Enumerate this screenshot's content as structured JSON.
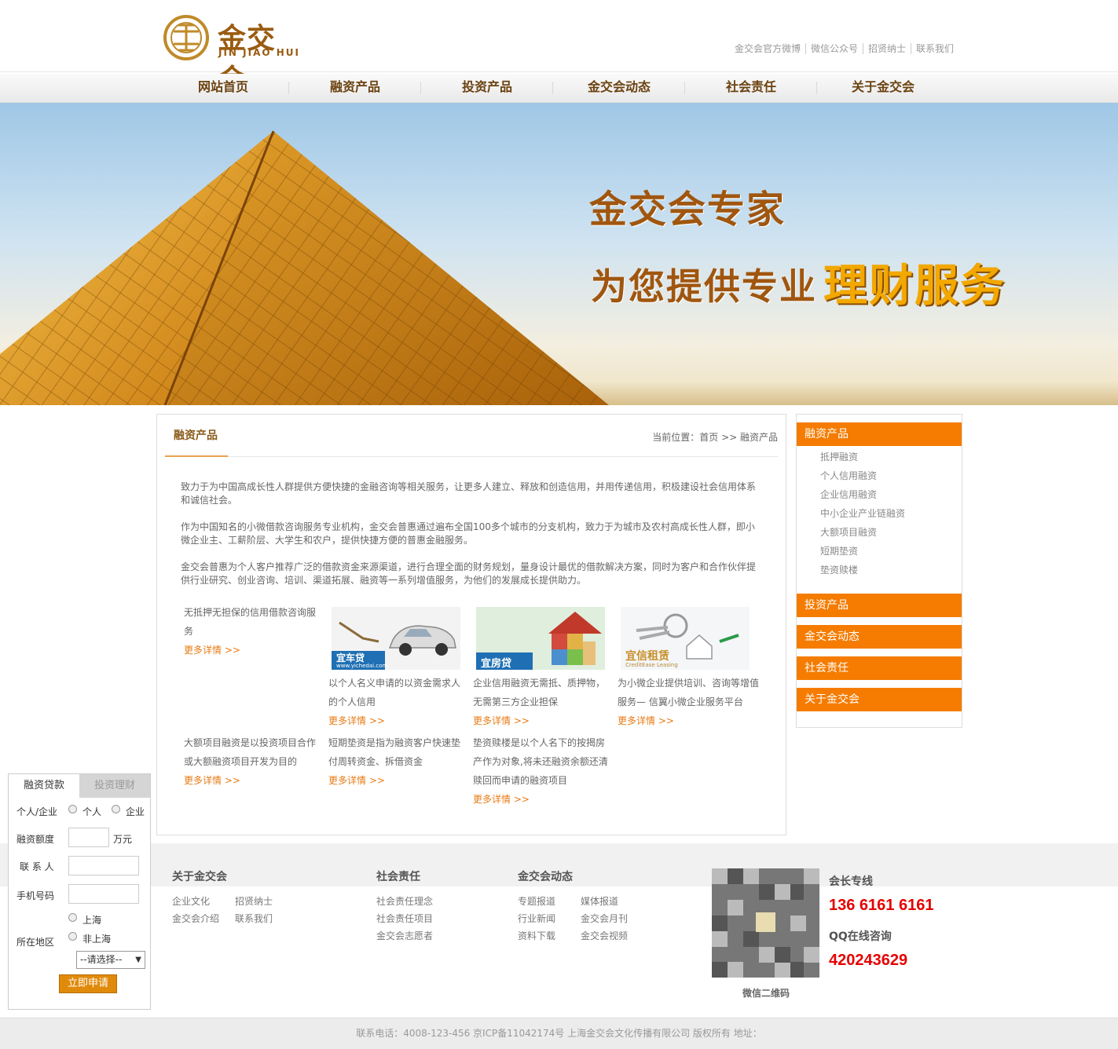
{
  "logo": {
    "cn": "金交会",
    "en": "JIN JIAO HUI"
  },
  "toplinks": [
    "金交会官方微博",
    "微信公众号",
    "招贤纳士",
    "联系我们"
  ],
  "nav": [
    "网站首页",
    "融资产品",
    "投资产品",
    "金交会动态",
    "社会责任",
    "关于金交会"
  ],
  "banner": {
    "line1": "金交会专家",
    "line2": "为您提供专业",
    "highlight": "理财服务"
  },
  "content": {
    "title": "融资产品",
    "breadcrumb": "当前位置：首页 >> 融资产品",
    "paragraphs": [
      "致力于为中国高成长性人群提供方便快捷的金融咨询等相关服务，让更多人建立、释放和创造信用，并用传递信用，积极建设社会信用体系和诚信社会。",
      "作为中国知名的小微借款咨询服务专业机构，金交会普惠通过遍布全国100多个城市的分支机构，致力于为城市及农村高成长性人群，即小微企业主、工薪阶层、大学生和农户，提供快捷方便的普惠金融服务。",
      "金交会普惠为个人客户推荐广泛的借款资金来源渠道，进行合理全面的财务规划，量身设计最优的借款解决方案，同时为客户和合作伙伴提供行业研究、创业咨询、培训、渠道拓展、融资等一系列增值服务，为他们的发展成长提供助力。"
    ],
    "more": "更多详情 >>",
    "products": [
      {
        "desc": "无抵押无担保的信用借款咨询服务"
      },
      {
        "desc": "以个人名义申请的以资金需求人的个人信用",
        "img_label": "宜车贷",
        "img_sub": "www.yichedai.com"
      },
      {
        "desc": "企业信用融资无需抵、质押物，无需第三方企业担保",
        "img_label": "宜房贷"
      },
      {
        "desc": "为小微企业提供培训、咨询等增值服务— 信翼小微企业服务平台",
        "img_label": "宜信租赁",
        "img_sub": "CreditEase Leasing"
      },
      {
        "desc": "大额项目融资是以投资项目合作或大额融资项目开发为目的"
      },
      {
        "desc": "短期垫资是指为融资客户快速垫付周转资金、拆借资金"
      },
      {
        "desc": "垫资赎楼是以个人名下的按揭房产作为对象,将未还融资余额还清赎回而申请的融资项目"
      }
    ]
  },
  "sidebar": {
    "sections": [
      "融资产品",
      "投资产品",
      "金交会动态",
      "社会责任",
      "关于金交会"
    ],
    "sub_items": [
      "抵押融资",
      "个人信用融资",
      "企业信用融资",
      "中小企业产业链融资",
      "大额项目融资",
      "短期垫资",
      "垫资赎楼"
    ]
  },
  "form": {
    "tabs": [
      "融资贷款",
      "投资理财"
    ],
    "type_label": "个人/企业",
    "type_options": [
      "个人",
      "企业"
    ],
    "amount_label": "融资额度",
    "amount_unit": "万元",
    "contact_label": "联 系 人",
    "phone_label": "手机号码",
    "region_label": "所在地区",
    "region_options": [
      "上海",
      "非上海"
    ],
    "select_value": "--请选择--",
    "submit": "立即申请"
  },
  "footer": {
    "cols": [
      {
        "title": "关于金交会",
        "links": [
          "企业文化",
          "招贤纳士",
          "金交会介绍",
          "联系我们"
        ]
      },
      {
        "title": "社会责任",
        "links": [
          "社会责任理念",
          "社会责任项目",
          "金交会志愿者"
        ]
      },
      {
        "title": "金交会动态",
        "links": [
          "专题报道",
          "媒体报道",
          "行业新闻",
          "金交会月刊",
          "资料下载",
          "金交会视频"
        ]
      }
    ],
    "qr_caption": "微信二维码",
    "hotline_label": "会长专线",
    "hotline": "136 6161 6161",
    "qq_label": "QQ在线咨询",
    "qq": "420243629",
    "copyright": "联系电话：4008-123-456 京ICP备11042174号 上海金交会文化传播有限公司 版权所有 地址："
  },
  "colors": {
    "accent": "#f57c00",
    "brand_brown": "#9a5b10",
    "hotline_red": "#e60000"
  }
}
